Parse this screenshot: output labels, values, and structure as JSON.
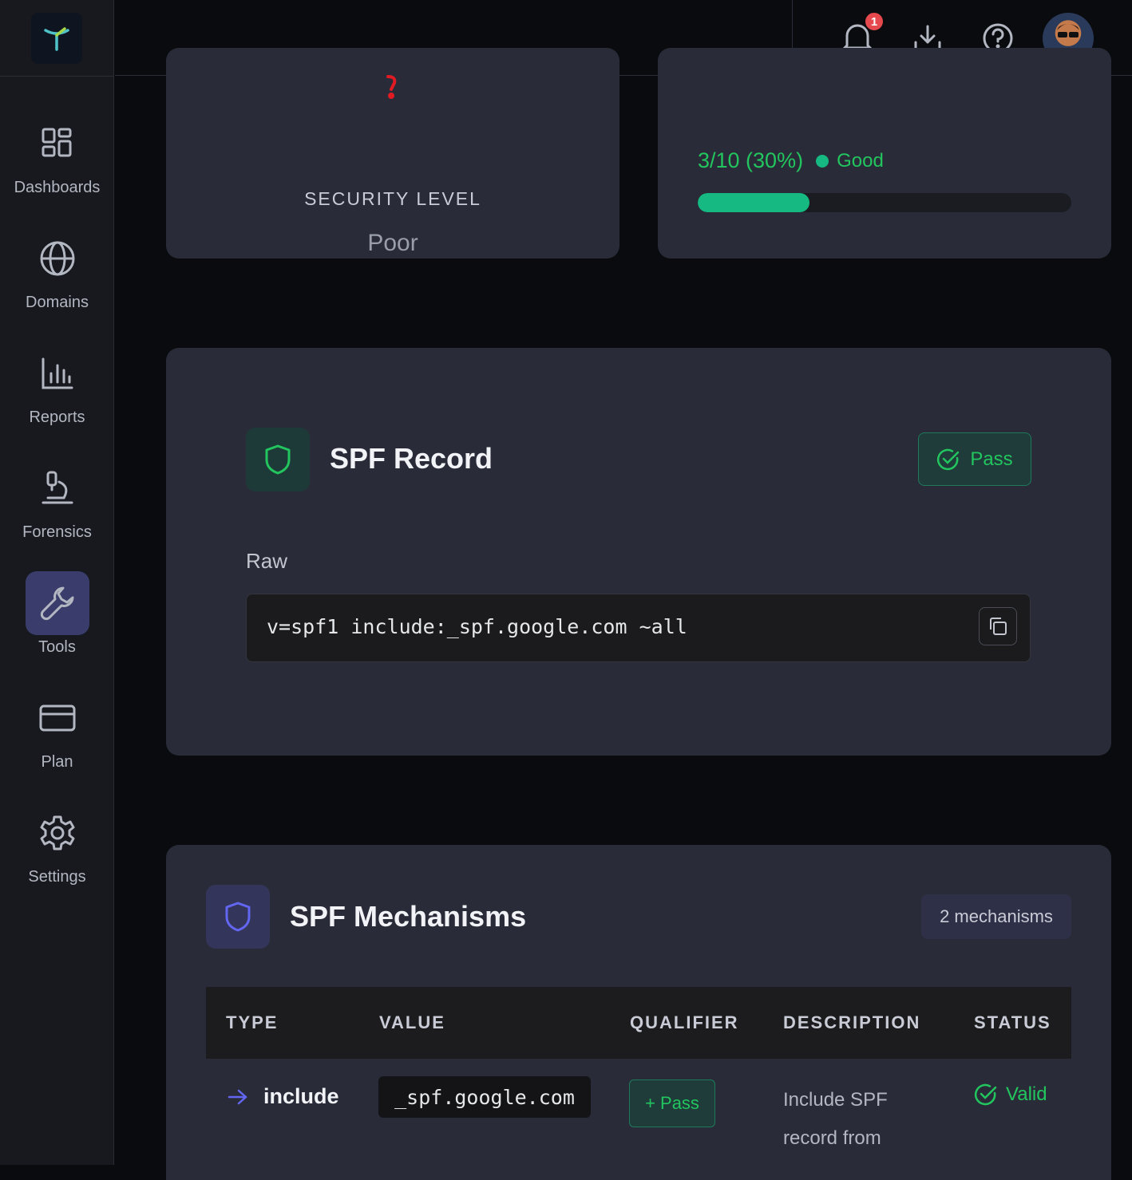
{
  "sidebar": {
    "items": [
      {
        "label": "Dashboards",
        "icon": "dashboard-icon"
      },
      {
        "label": "Domains",
        "icon": "globe-icon"
      },
      {
        "label": "Reports",
        "icon": "bar-chart-icon"
      },
      {
        "label": "Forensics",
        "icon": "microscope-icon"
      },
      {
        "label": "Tools",
        "icon": "wrench-icon",
        "active": true
      },
      {
        "label": "Plan",
        "icon": "credit-card-icon"
      },
      {
        "label": "Settings",
        "icon": "gear-icon"
      }
    ]
  },
  "topbar": {
    "notification_count": "1"
  },
  "security": {
    "label": "SECURITY LEVEL",
    "value": "Poor"
  },
  "score": {
    "text": "3/10 (30%)",
    "status": "Good",
    "progress_percent": 30
  },
  "spf_record": {
    "title": "SPF Record",
    "status_label": "Pass",
    "raw_label": "Raw",
    "raw_value": "v=spf1 include:_spf.google.com ~all"
  },
  "mechanisms": {
    "title": "SPF Mechanisms",
    "count_label": "2 mechanisms",
    "columns": [
      "TYPE",
      "VALUE",
      "QUALIFIER",
      "DESCRIPTION",
      "STATUS"
    ],
    "rows": [
      {
        "type": "include",
        "value": "_spf.google.com",
        "qualifier": "+ Pass",
        "description": "Include SPF record from",
        "status": "Valid"
      }
    ]
  },
  "colors": {
    "accent_green": "#22c55e",
    "accent_indigo": "#6366f1",
    "danger": "#e5484d"
  }
}
